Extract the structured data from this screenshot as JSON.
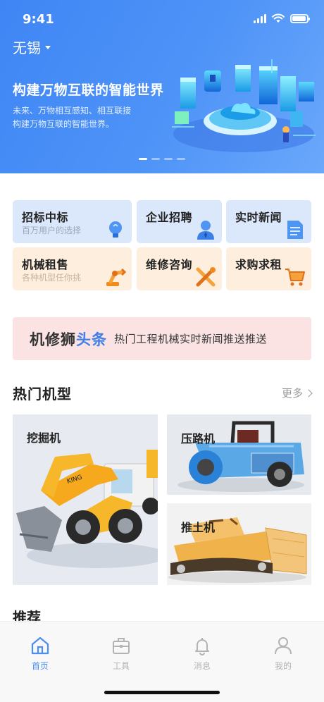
{
  "status": {
    "time": "9:41"
  },
  "location": {
    "city": "无锡"
  },
  "banner": {
    "title": "构建万物互联的智能世界",
    "subtitle_line1": "未来、万物相互感知、相互联接",
    "subtitle_line2": "构建万物互联的智能世界。",
    "active_dot": 0,
    "dot_count": 4
  },
  "services": [
    {
      "title": "招标中标",
      "subtitle": "百万用户的选择",
      "icon": "lightbulb-icon"
    },
    {
      "title": "企业招聘",
      "subtitle": "",
      "icon": "person-icon"
    },
    {
      "title": "实时新闻",
      "subtitle": "",
      "icon": "document-icon"
    },
    {
      "title": "机械租售",
      "subtitle": "各种机型任你挑",
      "icon": "robot-arm-icon"
    },
    {
      "title": "维修咨询",
      "subtitle": "",
      "icon": "tools-icon"
    },
    {
      "title": "求购求租",
      "subtitle": "",
      "icon": "cart-icon"
    }
  ],
  "headline": {
    "brand_part1": "机修狮",
    "brand_part2": "头条",
    "text": "热门工程机械实时新闻推送推送"
  },
  "hot_models": {
    "title": "热门机型",
    "more": "更多",
    "items": [
      {
        "label": "挖掘机"
      },
      {
        "label": "压路机"
      },
      {
        "label": "推土机"
      }
    ]
  },
  "recommend": {
    "title": "推荐"
  },
  "tabbar": {
    "items": [
      {
        "label": "首页",
        "icon": "home-icon",
        "active": true
      },
      {
        "label": "工具",
        "icon": "toolbox-icon",
        "active": false
      },
      {
        "label": "消息",
        "icon": "bell-icon",
        "active": false
      },
      {
        "label": "我的",
        "icon": "user-icon",
        "active": false
      }
    ]
  },
  "colors": {
    "primary": "#4a8df5",
    "card_blue": "#dbe7fb",
    "card_orange": "#fdeedd",
    "headline_bg": "#fbe3e3"
  }
}
